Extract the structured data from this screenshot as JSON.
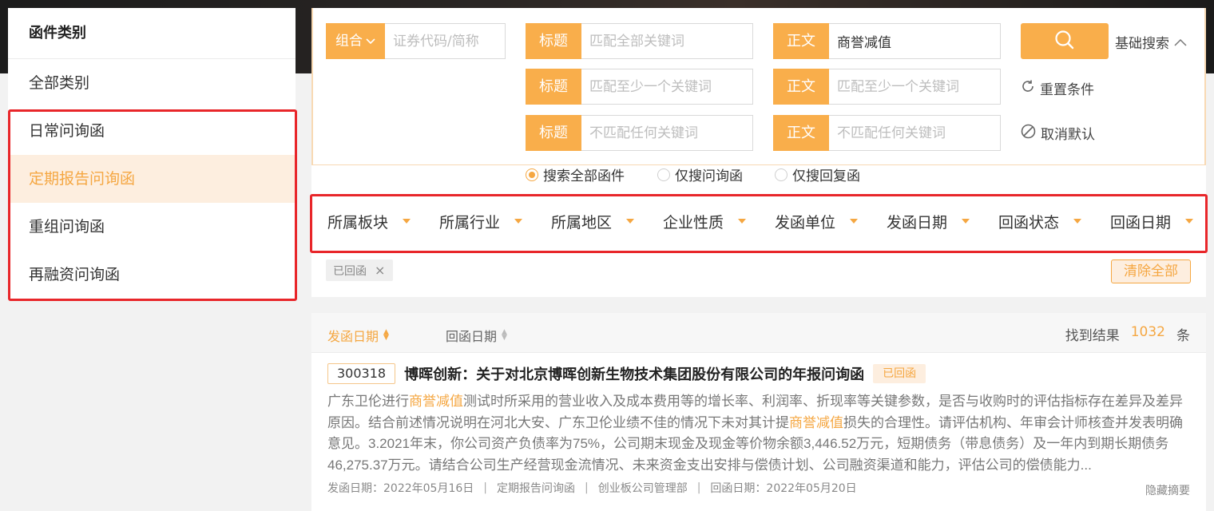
{
  "sidebar": {
    "title": "函件类别",
    "items": [
      {
        "label": "全部类别"
      },
      {
        "label": "日常问询函"
      },
      {
        "label": "定期报告问询函",
        "active": true
      },
      {
        "label": "重组问询函"
      },
      {
        "label": "再融资问询函"
      }
    ]
  },
  "search": {
    "combo_label": "组合",
    "code_placeholder": "证券代码/简称",
    "title_tag": "标题",
    "body_tag": "正文",
    "title_all_placeholder": "匹配全部关键词",
    "title_any_placeholder": "匹配至少一个关键词",
    "title_none_placeholder": "不匹配任何关键词",
    "body_all_value": "商誉减值",
    "body_any_placeholder": "匹配至少一个关键词",
    "body_none_placeholder": "不匹配任何关键词",
    "basic_search_label": "基础搜索",
    "reset_label": "重置条件",
    "cancel_default_label": "取消默认",
    "radios": [
      {
        "label": "搜索全部函件",
        "checked": true
      },
      {
        "label": "仅搜问询函",
        "checked": false
      },
      {
        "label": "仅搜回复函",
        "checked": false
      }
    ]
  },
  "filters": [
    "所属板块",
    "所属行业",
    "所属地区",
    "企业性质",
    "发函单位",
    "发函日期",
    "回函状态",
    "回函日期"
  ],
  "active_chip": {
    "label": "已回函",
    "close": "×"
  },
  "clear_all_label": "清除全部",
  "results_header": {
    "sort_send": "发函日期",
    "sort_reply": "回函日期",
    "found_label": "找到结果",
    "count": "1032",
    "unit": "条"
  },
  "result": {
    "code": "300318",
    "title": "博晖创新：关于对北京博晖创新生物技术集团股份有限公司的年报问询函",
    "status": "已回函",
    "abstract_segments": [
      {
        "text": "广东卫伦进行",
        "hl": false
      },
      {
        "text": "商誉减值",
        "hl": true
      },
      {
        "text": "测试时所采用的营业收入及成本费用等的增长率、利润率、折现率等关键参数，是否与收购时的评估指标存在差异及差异原因。结合前述情况说明在河北大安、广东卫伦业绩不佳的情况下未对其计提",
        "hl": false
      },
      {
        "text": "商誉减值",
        "hl": true
      },
      {
        "text": "损失的合理性。请评估机构、年审会计师核查并发表明确意见。3.2021年末，你公司资产负债率为75%，公司期末现金及现金等价物余额3,446.52万元，短期债务（带息债务）及一年内到期长期债务46,275.37万元。请结合公司生产经营现金流情况、未来资金支出安排与偿债计划、公司融资渠道和能力，评估公司的偿债能力...",
        "hl": false
      }
    ],
    "meta": {
      "send_date": "发函日期：2022年05月16日",
      "category": "定期报告问询函",
      "department": "创业板公司管理部",
      "reply_date": "回函日期：2022年05月20日"
    },
    "hide_label": "隐藏摘要"
  },
  "colors": {
    "accent": "#f9ae4b",
    "accent_text": "#f5a742",
    "highlight_box": "#e8262a"
  }
}
